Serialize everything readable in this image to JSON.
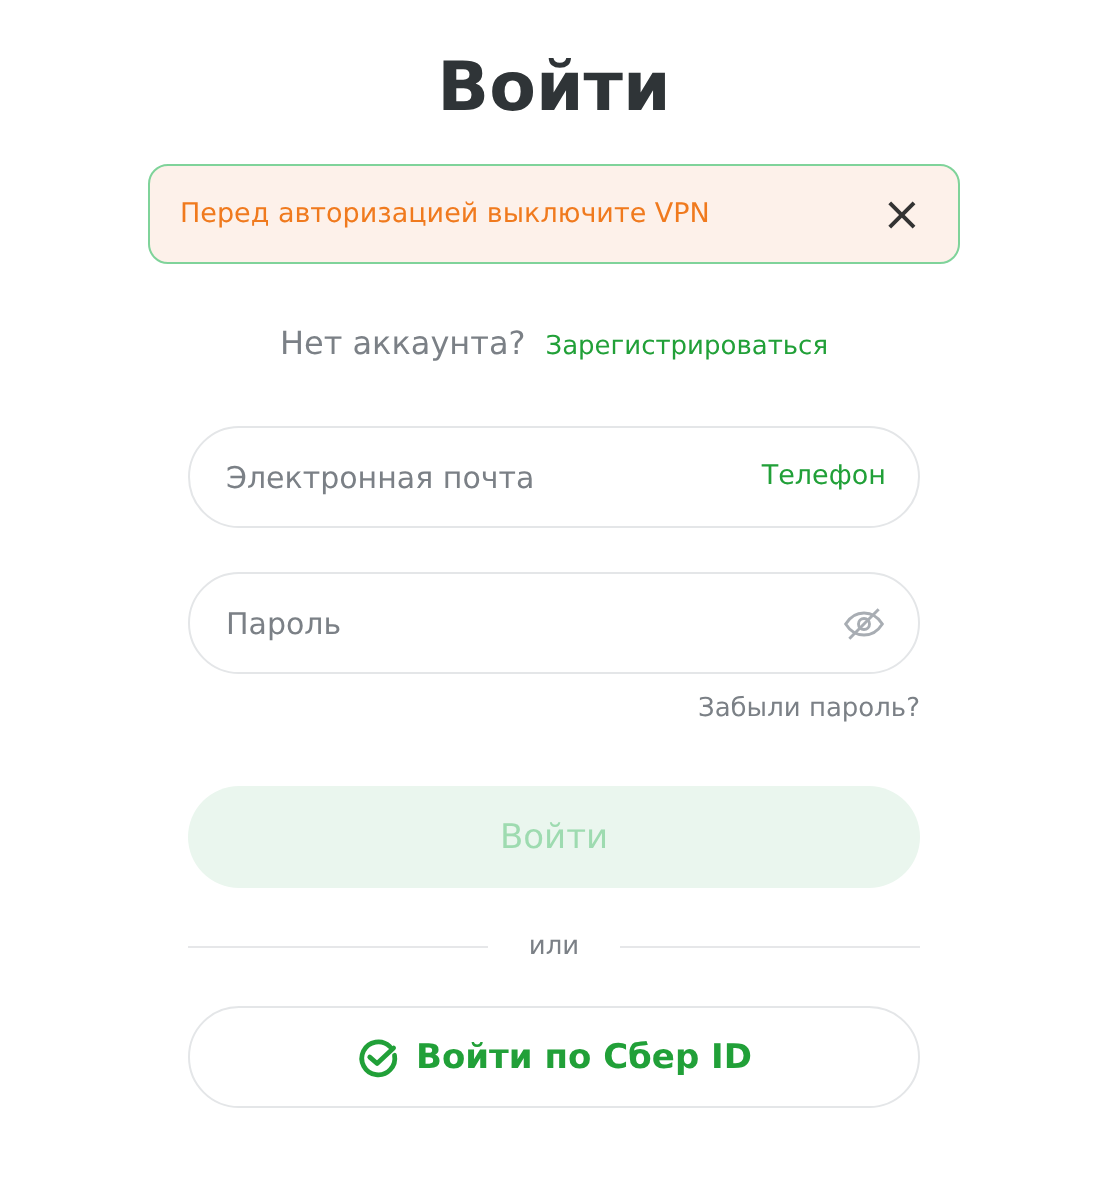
{
  "title": "Войти",
  "alert": {
    "text": "Перед авторизацией выключите VPN",
    "close": "×"
  },
  "register": {
    "question": "Нет аккаунта?",
    "link": "Зарегистрироваться"
  },
  "fields": [
    {
      "kind": "email",
      "placeholder": "Электронная почта",
      "switch_label": "Телефон"
    },
    {
      "kind": "password",
      "placeholder": "Пароль",
      "revealed": false
    }
  ],
  "forgot": "Забыли пароль?",
  "login_button": {
    "label": "Войти",
    "disabled": true
  },
  "divider": "или",
  "sber_button": {
    "label": "Войти по Сбер ID"
  }
}
